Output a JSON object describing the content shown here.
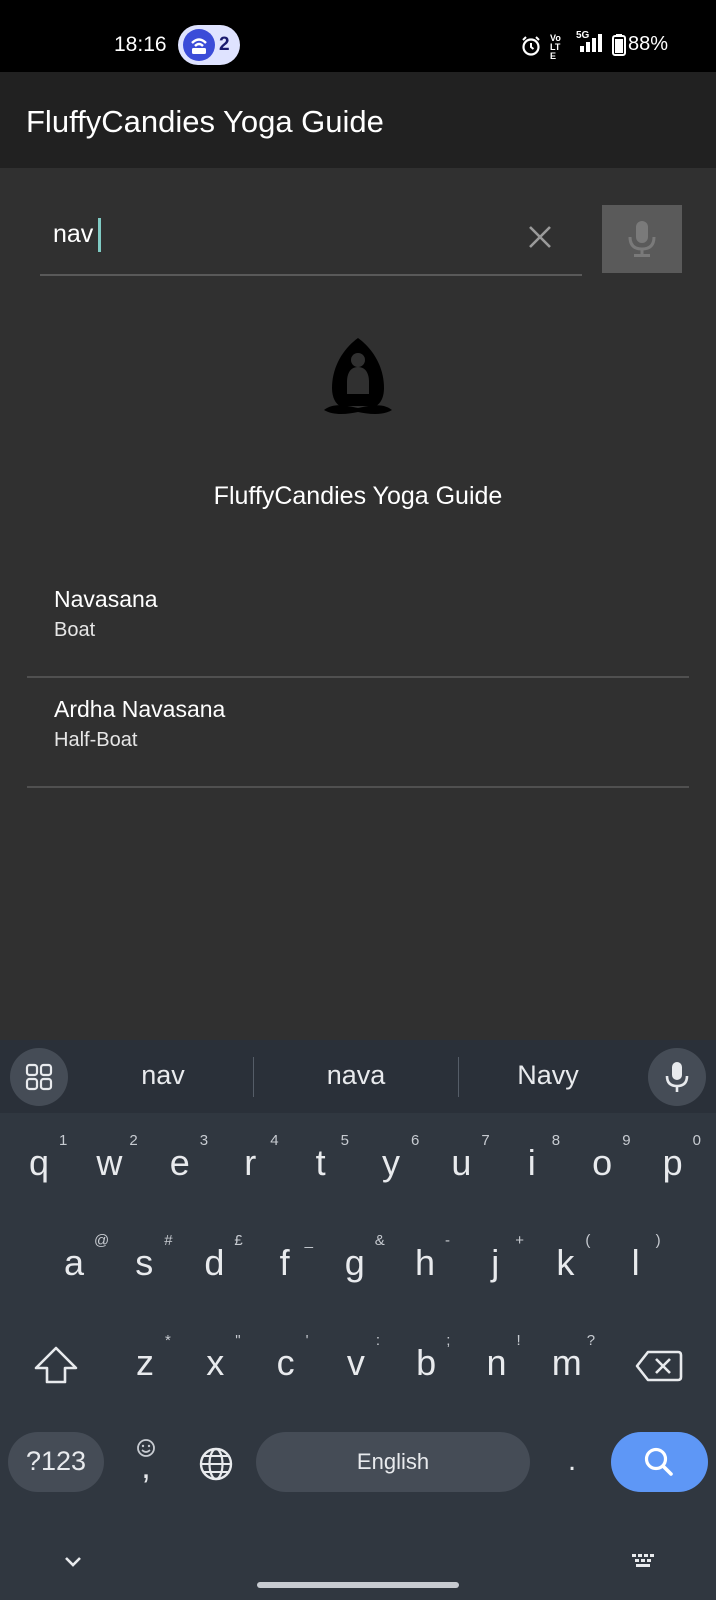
{
  "status_bar": {
    "time": "18:16",
    "hotspot_count": "2",
    "battery_percent": "88%",
    "network_label": "Vo LTE",
    "signal_label": "5G"
  },
  "app_bar": {
    "title": "FluffyCandies Yoga Guide"
  },
  "search": {
    "query": "nav"
  },
  "header": {
    "app_name": "FluffyCandies Yoga Guide"
  },
  "results": [
    {
      "name": "Navasana",
      "english": "Boat"
    },
    {
      "name": "Ardha Navasana",
      "english": "Half-Boat"
    }
  ],
  "keyboard": {
    "suggestions": [
      "nav",
      "nava",
      "Navy"
    ],
    "row1": [
      "q",
      "w",
      "e",
      "r",
      "t",
      "y",
      "u",
      "i",
      "o",
      "p"
    ],
    "row1_hints": [
      "1",
      "2",
      "3",
      "4",
      "5",
      "6",
      "7",
      "8",
      "9",
      "0"
    ],
    "row2": [
      "a",
      "s",
      "d",
      "f",
      "g",
      "h",
      "j",
      "k",
      "l"
    ],
    "row2_hints": [
      "@",
      "#",
      "£",
      "_",
      "&",
      "-",
      "+",
      "(",
      ")"
    ],
    "row3": [
      "z",
      "x",
      "c",
      "v",
      "b",
      "n",
      "m"
    ],
    "row3_hints": [
      "*",
      "\"",
      "'",
      ":",
      ";",
      "!",
      "?"
    ],
    "symbols_label": "?123",
    "comma": ",",
    "space_label": "English",
    "period": ".",
    "accent_color": "#5e97f6"
  }
}
